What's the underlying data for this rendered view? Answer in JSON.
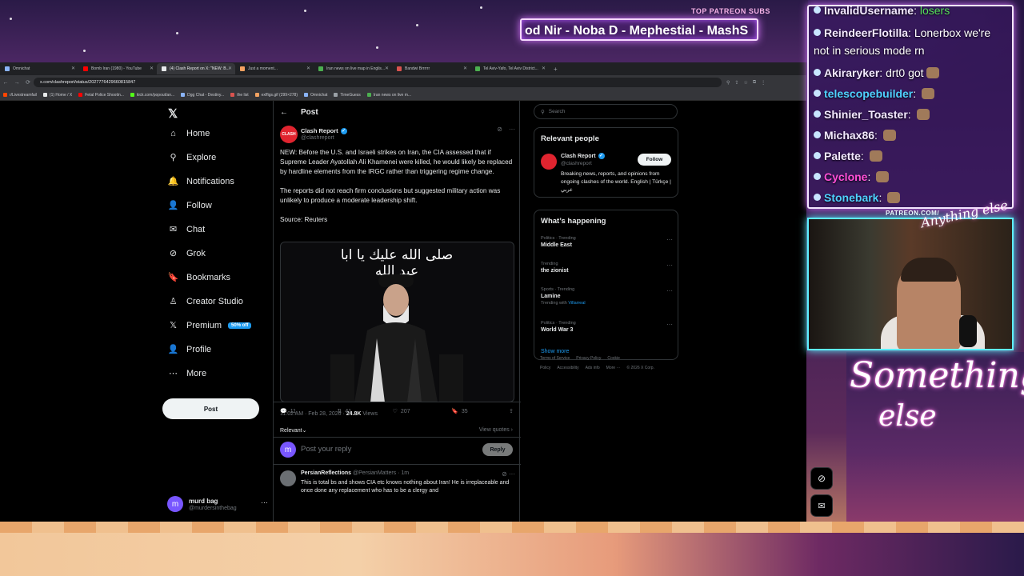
{
  "stream_overlay": {
    "patreon_label": "TOP PATREON SUBS",
    "patreon_names": "od Nir - Noba D - Mephestial - MashS",
    "patreon_url": "PATREON.COM/",
    "chat": [
      {
        "user": "InvalidUsername",
        "msg": "losers"
      },
      {
        "user": "ReindeerFlotilla",
        "msg": "Lonerbox we're"
      },
      {
        "user": "",
        "msg": "not in serious mode rn"
      },
      {
        "user": "Akiraryker",
        "msg": "drt0 got"
      },
      {
        "user": "telescopebuilder",
        "msg": ""
      },
      {
        "user": "Shinier_Toaster",
        "msg": ""
      },
      {
        "user": "Michax86",
        "msg": ""
      },
      {
        "user": "Palette",
        "msg": ""
      },
      {
        "user": "Cyclone",
        "msg": ""
      },
      {
        "user": "Stonebark",
        "msg": ""
      }
    ]
  },
  "browser": {
    "tabs": [
      {
        "label": "Omnichat",
        "color": "#8ab4f8",
        "active": false
      },
      {
        "label": "Bomb Iran (1980) - YouTube",
        "color": "#ff0000",
        "active": false
      },
      {
        "label": "(4) Clash Report on X: \"NEW: B...",
        "color": "#e7e9ea",
        "active": true
      },
      {
        "label": "Just a moment...",
        "color": "#f4a261",
        "active": false
      },
      {
        "label": "Iran news on live map in Englis...",
        "color": "#4caf50",
        "active": false
      },
      {
        "label": "Bandwi Brrrrrr",
        "color": "#d9534f",
        "active": false
      },
      {
        "label": "Tel Aviv-Yafo, Tel Aviv District...",
        "color": "#4caf50",
        "active": false
      }
    ],
    "url": "x.com/clashreport/status/2027776429660815847",
    "bookmarks": [
      {
        "label": "r/Livestreamfail",
        "color": "#ff4500"
      },
      {
        "label": "(1) Home / X",
        "color": "#e7e9ea"
      },
      {
        "label": "Fetal Police Shootin...",
        "color": "#ff0000"
      },
      {
        "label": "kick.com/popout/an...",
        "color": "#53fc18"
      },
      {
        "label": "Dgg Chat - Destiny...",
        "color": "#8ab4f8"
      },
      {
        "label": "the list",
        "color": "#d9534f"
      },
      {
        "label": "exffigs.gif (299×278)",
        "color": "#f4a261"
      },
      {
        "label": "Omnichat",
        "color": "#8ab4f8"
      },
      {
        "label": "TimeGuess",
        "color": "#9aa0a6"
      },
      {
        "label": "Iran news on live m...",
        "color": "#4caf50"
      }
    ]
  },
  "nav": {
    "items": [
      {
        "label": "Home",
        "icon": "home-icon",
        "glyph": "⌂"
      },
      {
        "label": "Explore",
        "icon": "search-icon",
        "glyph": "⚲"
      },
      {
        "label": "Notifications",
        "icon": "bell-icon",
        "glyph": "🔔"
      },
      {
        "label": "Follow",
        "icon": "follow-icon",
        "glyph": "👤"
      },
      {
        "label": "Chat",
        "icon": "mail-icon",
        "glyph": "✉"
      },
      {
        "label": "Grok",
        "icon": "grok-icon",
        "glyph": "⊘"
      },
      {
        "label": "Bookmarks",
        "icon": "bookmark-icon",
        "glyph": "🔖"
      },
      {
        "label": "Creator Studio",
        "icon": "creator-icon",
        "glyph": "♙"
      },
      {
        "label": "Premium",
        "icon": "x-logo-icon",
        "glyph": "𝕏"
      },
      {
        "label": "Profile",
        "icon": "profile-icon",
        "glyph": "👤"
      },
      {
        "label": "More",
        "icon": "more-icon",
        "glyph": "⋯"
      }
    ],
    "premium_badge": "50% off",
    "post_button": "Post",
    "account_name": "murd bag",
    "account_handle": "@murdersinthebag",
    "account_initial": "m"
  },
  "post": {
    "header": "Post",
    "author_name": "Clash Report",
    "author_handle": "@clashreport",
    "paragraphs": [
      "NEW: Before the U.S. and Israeli strikes on Iran, the CIA assessed that if Supreme Leader Ayatollah Ali Khamenei were killed, he would likely be replaced by hardline elements from the IRGC rather than triggering regime change.",
      "The reports did not reach firm conclusions but suggested military action was unlikely to produce a moderate leadership shift.",
      "Source: Reuters"
    ],
    "timestamp": "11:02 AM · Feb 28, 2026 · ",
    "views_count": "24.8K",
    "views_label": " Views",
    "replies": "11",
    "reposts": "41",
    "likes": "207",
    "bookmarks": "35",
    "sort_label": "Relevant",
    "view_quotes": "View quotes",
    "reply_placeholder": "Post your reply",
    "reply_button": "Reply",
    "image_caption_arabic": "صلى الله عليك يا ابا عبد الله"
  },
  "reply": {
    "name": "PersianReflections",
    "handle": "@PersianMatters · 1m",
    "text": "This is total bs and shows CIA etc knows nothing about Iran! He is irreplaceable and once done any replacement who has to be a clergy and"
  },
  "sidebar": {
    "search_placeholder": "Search",
    "relevant_title": "Relevant people",
    "rp_name": "Clash Report",
    "rp_handle": "@clashreport",
    "rp_follow": "Follow",
    "rp_bio": "Breaking news, reports, and opinions from ongoing clashes of the world. English | Türkçe | عربي",
    "happening_title": "What’s happening",
    "trends": [
      {
        "cat": "Politics · Trending",
        "name": "Middle East",
        "with": "",
        "with_link": ""
      },
      {
        "cat": "Trending",
        "name": "the zionist",
        "with": "",
        "with_link": ""
      },
      {
        "cat": "Sports · Trending",
        "name": "Lamine",
        "with": "Trending with ",
        "with_link": "Villarreal"
      },
      {
        "cat": "Politics · Trending",
        "name": "World War 3",
        "with": "",
        "with_link": ""
      }
    ],
    "show_more": "Show more",
    "footer": [
      "Terms of Service",
      "Privacy Policy",
      "Cookie Policy",
      "Accessibility",
      "Ads info",
      "More ···",
      "© 2026 X Corp."
    ]
  },
  "colors": {
    "accent": "#1d9bf0",
    "brand_red": "#e0242f"
  }
}
